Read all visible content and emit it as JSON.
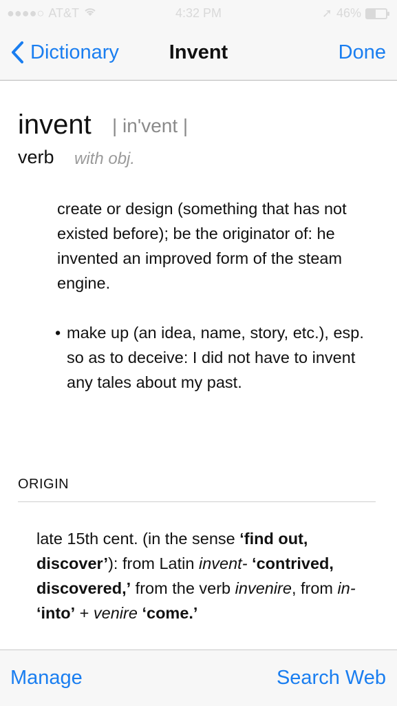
{
  "status_bar": {
    "carrier": "AT&T",
    "time": "4:32 PM",
    "battery": "46%",
    "battery_level": 0.46,
    "icons": [
      "signal-dots-icon",
      "wifi-icon",
      "location-arrow-icon",
      "battery-icon"
    ]
  },
  "nav": {
    "back_label": "Dictionary",
    "title": "Invent",
    "done_label": "Done"
  },
  "entry": {
    "headword": "invent",
    "pronunciation": "| in'vent |",
    "part_of_speech": "verb",
    "pos_note": "with obj.",
    "definition": "create or design (something that has not existed before); be the originator of: he invented an improved form of the steam engine.",
    "subsense": "make up (an idea, name, story, etc.), esp. so as to deceive: I did not have to invent any tales about my past."
  },
  "origin": {
    "heading": "ORIGIN",
    "segments": [
      {
        "text": "late 15th cent. (in the sense ",
        "style": "normal"
      },
      {
        "text": "‘find out, discover’",
        "style": "bold"
      },
      {
        "text": "): from Latin ",
        "style": "normal"
      },
      {
        "text": "invent-",
        "style": "italic"
      },
      {
        "text": " ",
        "style": "normal"
      },
      {
        "text": "‘contrived, discovered,’",
        "style": "bold"
      },
      {
        "text": " from the verb ",
        "style": "normal"
      },
      {
        "text": "invenire",
        "style": "italic"
      },
      {
        "text": ", from ",
        "style": "normal"
      },
      {
        "text": "in-",
        "style": "italic"
      },
      {
        "text": " ",
        "style": "normal"
      },
      {
        "text": "‘into’",
        "style": "bold"
      },
      {
        "text": " + ",
        "style": "normal"
      },
      {
        "text": "venire",
        "style": "italic"
      },
      {
        "text": " ",
        "style": "normal"
      },
      {
        "text": "‘come.’",
        "style": "bold"
      }
    ]
  },
  "toolbar": {
    "manage_label": "Manage",
    "search_label": "Search Web"
  },
  "colors": {
    "accent": "#1a7ef0",
    "bar_background": "#f7f7f7"
  }
}
